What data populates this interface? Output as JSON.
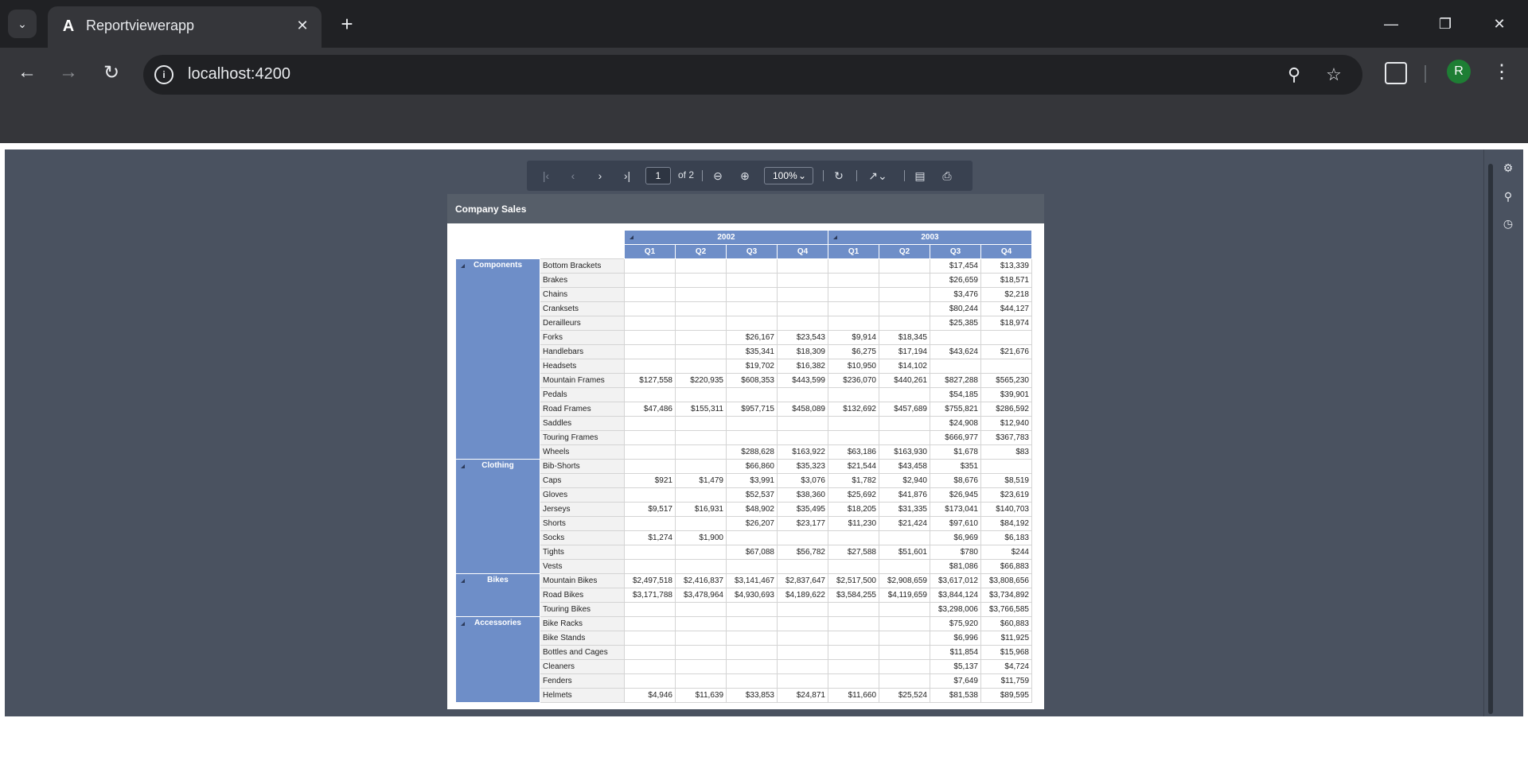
{
  "browser": {
    "tab_title": "Reportviewerapp",
    "tab_favicon": "A",
    "url": "localhost:4200",
    "profile_initial": "R"
  },
  "viewer_toolbar": {
    "page_value": "1",
    "page_count_label": "of 2",
    "zoom_label": "100%"
  },
  "report": {
    "title": "Company Sales",
    "years": [
      "2002",
      "2003"
    ],
    "quarters": [
      "Q1",
      "Q2",
      "Q3",
      "Q4",
      "Q1",
      "Q2",
      "Q3",
      "Q4"
    ],
    "groups": [
      {
        "category": "Components",
        "rows": [
          {
            "product": "Bottom Brackets",
            "values": [
              "",
              "",
              "",
              "",
              "",
              "",
              "$17,454",
              "$13,339"
            ]
          },
          {
            "product": "Brakes",
            "values": [
              "",
              "",
              "",
              "",
              "",
              "",
              "$26,659",
              "$18,571"
            ]
          },
          {
            "product": "Chains",
            "values": [
              "",
              "",
              "",
              "",
              "",
              "",
              "$3,476",
              "$2,218"
            ]
          },
          {
            "product": "Cranksets",
            "values": [
              "",
              "",
              "",
              "",
              "",
              "",
              "$80,244",
              "$44,127"
            ]
          },
          {
            "product": "Derailleurs",
            "values": [
              "",
              "",
              "",
              "",
              "",
              "",
              "$25,385",
              "$18,974"
            ]
          },
          {
            "product": "Forks",
            "values": [
              "",
              "",
              "$26,167",
              "$23,543",
              "$9,914",
              "$18,345",
              "",
              ""
            ]
          },
          {
            "product": "Handlebars",
            "values": [
              "",
              "",
              "$35,341",
              "$18,309",
              "$6,275",
              "$17,194",
              "$43,624",
              "$21,676"
            ]
          },
          {
            "product": "Headsets",
            "values": [
              "",
              "",
              "$19,702",
              "$16,382",
              "$10,950",
              "$14,102",
              "",
              ""
            ]
          },
          {
            "product": "Mountain Frames",
            "values": [
              "$127,558",
              "$220,935",
              "$608,353",
              "$443,599",
              "$236,070",
              "$440,261",
              "$827,288",
              "$565,230"
            ]
          },
          {
            "product": "Pedals",
            "values": [
              "",
              "",
              "",
              "",
              "",
              "",
              "$54,185",
              "$39,901"
            ]
          },
          {
            "product": "Road Frames",
            "values": [
              "$47,486",
              "$155,311",
              "$957,715",
              "$458,089",
              "$132,692",
              "$457,689",
              "$755,821",
              "$286,592"
            ]
          },
          {
            "product": "Saddles",
            "values": [
              "",
              "",
              "",
              "",
              "",
              "",
              "$24,908",
              "$12,940"
            ]
          },
          {
            "product": "Touring Frames",
            "values": [
              "",
              "",
              "",
              "",
              "",
              "",
              "$666,977",
              "$367,783"
            ]
          },
          {
            "product": "Wheels",
            "values": [
              "",
              "",
              "$288,628",
              "$163,922",
              "$63,186",
              "$163,930",
              "$1,678",
              "$83"
            ]
          }
        ]
      },
      {
        "category": "Clothing",
        "rows": [
          {
            "product": "Bib-Shorts",
            "values": [
              "",
              "",
              "$66,860",
              "$35,323",
              "$21,544",
              "$43,458",
              "$351",
              ""
            ]
          },
          {
            "product": "Caps",
            "values": [
              "$921",
              "$1,479",
              "$3,991",
              "$3,076",
              "$1,782",
              "$2,940",
              "$8,676",
              "$8,519"
            ]
          },
          {
            "product": "Gloves",
            "values": [
              "",
              "",
              "$52,537",
              "$38,360",
              "$25,692",
              "$41,876",
              "$26,945",
              "$23,619"
            ]
          },
          {
            "product": "Jerseys",
            "values": [
              "$9,517",
              "$16,931",
              "$48,902",
              "$35,495",
              "$18,205",
              "$31,335",
              "$173,041",
              "$140,703"
            ]
          },
          {
            "product": "Shorts",
            "values": [
              "",
              "",
              "$26,207",
              "$23,177",
              "$11,230",
              "$21,424",
              "$97,610",
              "$84,192"
            ]
          },
          {
            "product": "Socks",
            "values": [
              "$1,274",
              "$1,900",
              "",
              "",
              "",
              "",
              "$6,969",
              "$6,183"
            ]
          },
          {
            "product": "Tights",
            "values": [
              "",
              "",
              "$67,088",
              "$56,782",
              "$27,588",
              "$51,601",
              "$780",
              "$244"
            ]
          },
          {
            "product": "Vests",
            "values": [
              "",
              "",
              "",
              "",
              "",
              "",
              "$81,086",
              "$66,883"
            ]
          }
        ]
      },
      {
        "category": "Bikes",
        "rows": [
          {
            "product": "Mountain Bikes",
            "values": [
              "$2,497,518",
              "$2,416,837",
              "$3,141,467",
              "$2,837,647",
              "$2,517,500",
              "$2,908,659",
              "$3,617,012",
              "$3,808,656"
            ]
          },
          {
            "product": "Road Bikes",
            "values": [
              "$3,171,788",
              "$3,478,964",
              "$4,930,693",
              "$4,189,622",
              "$3,584,255",
              "$4,119,659",
              "$3,844,124",
              "$3,734,892"
            ]
          },
          {
            "product": "Touring Bikes",
            "values": [
              "",
              "",
              "",
              "",
              "",
              "",
              "$3,298,006",
              "$3,766,585"
            ]
          }
        ]
      },
      {
        "category": "Accessories",
        "rows": [
          {
            "product": "Bike Racks",
            "values": [
              "",
              "",
              "",
              "",
              "",
              "",
              "$75,920",
              "$60,883"
            ]
          },
          {
            "product": "Bike Stands",
            "values": [
              "",
              "",
              "",
              "",
              "",
              "",
              "$6,996",
              "$11,925"
            ]
          },
          {
            "product": "Bottles and Cages",
            "values": [
              "",
              "",
              "",
              "",
              "",
              "",
              "$11,854",
              "$15,968"
            ]
          },
          {
            "product": "Cleaners",
            "values": [
              "",
              "",
              "",
              "",
              "",
              "",
              "$5,137",
              "$4,724"
            ]
          },
          {
            "product": "Fenders",
            "values": [
              "",
              "",
              "",
              "",
              "",
              "",
              "$7,649",
              "$11,759"
            ]
          },
          {
            "product": "Helmets",
            "values": [
              "$4,946",
              "$11,639",
              "$33,853",
              "$24,871",
              "$11,660",
              "$25,524",
              "$81,538",
              "$89,595"
            ]
          }
        ]
      }
    ]
  }
}
